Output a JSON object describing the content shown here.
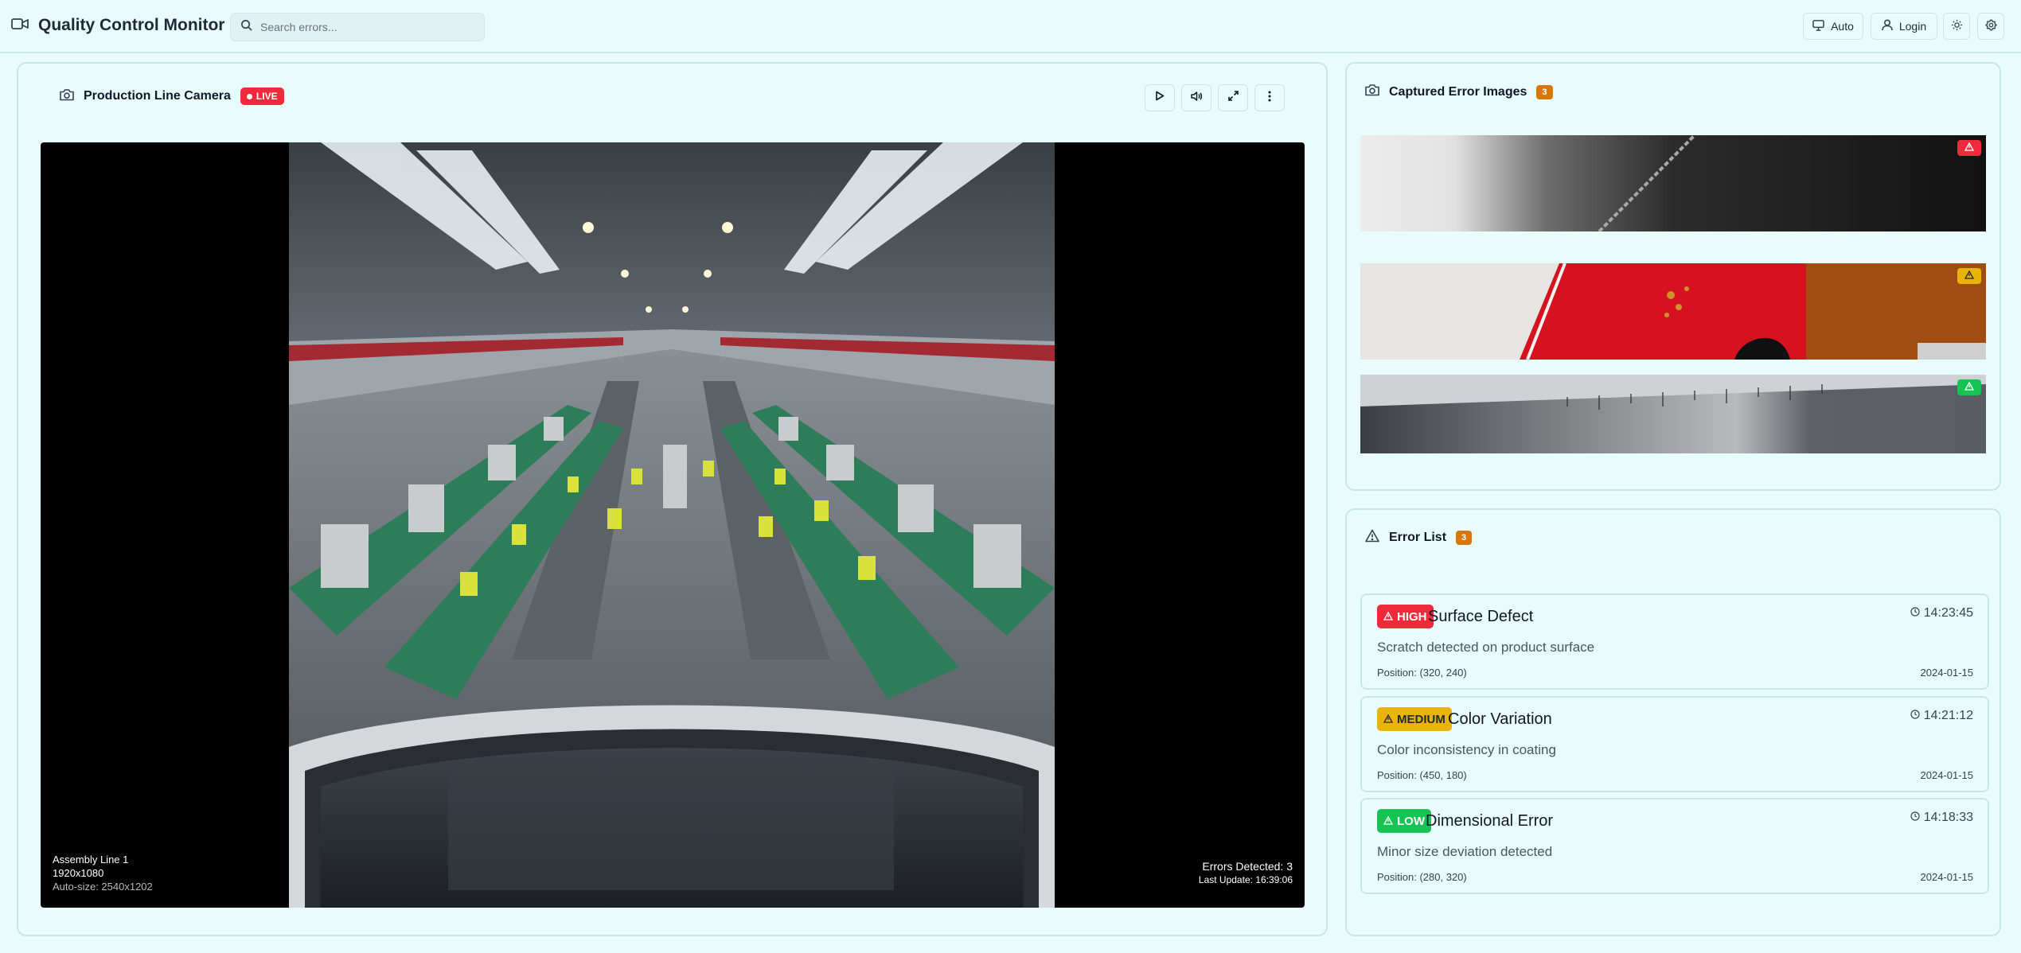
{
  "header": {
    "app_title": "Quality Control Monitor",
    "search_placeholder": "Search errors...",
    "auto_label": "Auto",
    "login_label": "Login"
  },
  "video_panel": {
    "title": "Production Line Camera",
    "live_label": "LIVE",
    "line_name": "Assembly Line 1",
    "resolution": "1920x1080",
    "auto_size": "Auto-size: 2540x1202",
    "errors_detected": "Errors Detected: 3",
    "last_update": "Last Update: 16:39:06"
  },
  "captures_panel": {
    "title": "Captured Error Images",
    "count": "3",
    "items": [
      {
        "severity": "high",
        "color": "#ef2b3b"
      },
      {
        "severity": "medium",
        "color": "#eab308"
      },
      {
        "severity": "low",
        "color": "#16c454"
      }
    ]
  },
  "errors_panel": {
    "title": "Error List",
    "count": "3",
    "items": [
      {
        "severity": "HIGH",
        "title": "Surface Defect",
        "time": "14:23:45",
        "description": "Scratch detected on product surface",
        "position": "Position: (320, 240)",
        "date": "2024-01-15"
      },
      {
        "severity": "MEDIUM",
        "title": "Color Variation",
        "time": "14:21:12",
        "description": "Color inconsistency in coating",
        "position": "Position: (450, 180)",
        "date": "2024-01-15"
      },
      {
        "severity": "LOW",
        "title": "Dimensional Error",
        "time": "14:18:33",
        "description": "Minor size deviation detected",
        "position": "Position: (280, 320)",
        "date": "2024-01-15"
      }
    ]
  },
  "colors": {
    "background": "#e8fcfc",
    "border": "#c9e6e6",
    "high": "#ef2b3b",
    "medium": "#eab308",
    "low": "#16c454",
    "count_badge": "#d97706"
  }
}
